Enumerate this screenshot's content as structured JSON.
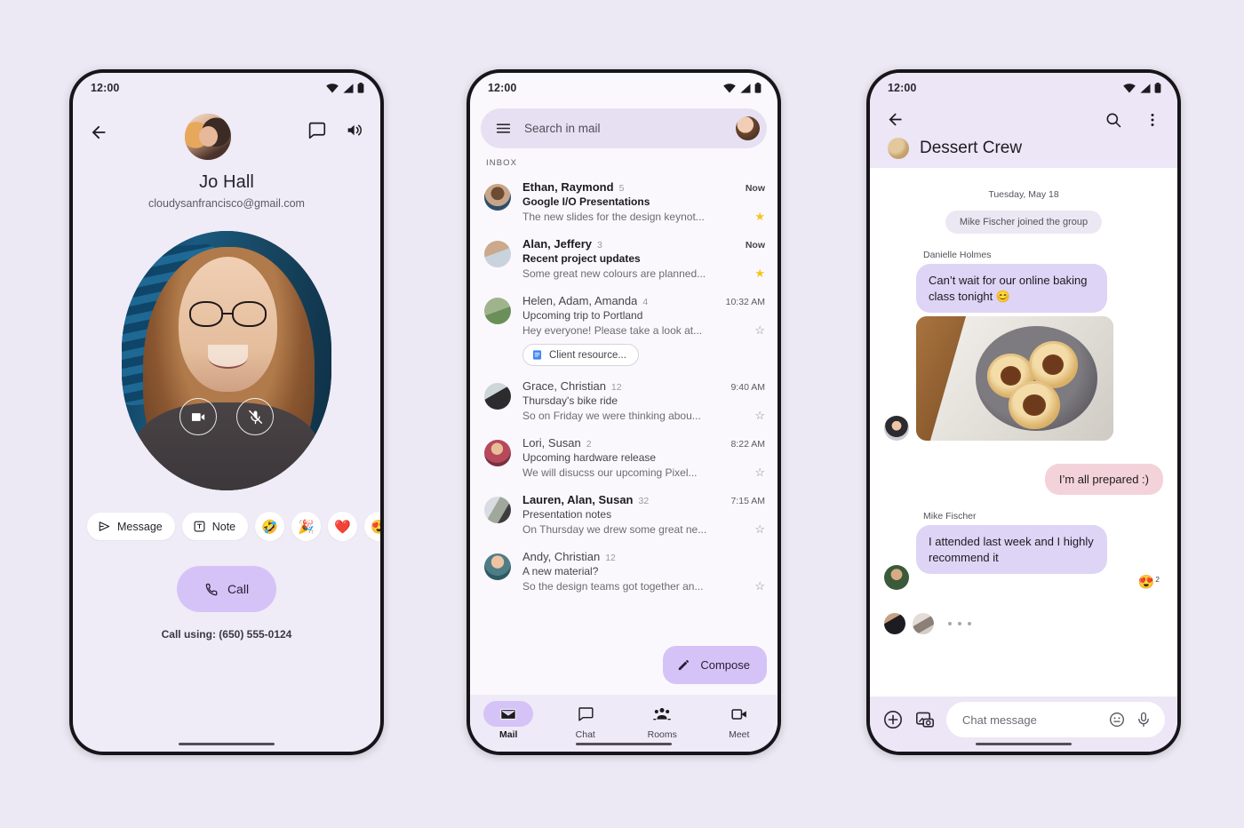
{
  "background_color": "#ece9f4",
  "accent_color": "#d5c3f7",
  "phone1": {
    "name": "contact-call-screen",
    "status": {
      "time": "12:00"
    },
    "header": {
      "back_icon": "arrow-back-icon",
      "chat_icon": "chat-bubble-icon",
      "volume_icon": "volume-up-icon"
    },
    "contact": {
      "name": "Jo Hall",
      "email": "cloudysanfrancisco@gmail.com"
    },
    "video": {
      "camera_icon": "video-camera-icon",
      "mic_muted_icon": "mic-off-icon"
    },
    "actions": [
      {
        "label": "Message",
        "icon": "send-icon",
        "type": "chip"
      },
      {
        "label": "Note",
        "icon": "note-icon",
        "type": "chip"
      },
      {
        "label": "🤣",
        "icon": "emoji-joy",
        "type": "emoji"
      },
      {
        "label": "🎉",
        "icon": "emoji-party",
        "type": "emoji"
      },
      {
        "label": "❤️",
        "icon": "emoji-heart",
        "type": "emoji"
      },
      {
        "label": "😍",
        "icon": "emoji-heart-eyes",
        "type": "emoji"
      }
    ],
    "call_button": {
      "label": "Call",
      "icon": "phone-icon"
    },
    "call_using": "Call using: (650) 555-0124"
  },
  "phone2": {
    "name": "gmail-inbox-screen",
    "status": {
      "time": "12:00"
    },
    "search": {
      "menu_icon": "hamburger-menu-icon",
      "placeholder": "Search in mail",
      "avatar": "account-avatar"
    },
    "section_label": "INBOX",
    "emails": [
      {
        "sender": "Ethan, Raymond",
        "count": "5",
        "time": "Now",
        "subject": "Google I/O Presentations",
        "snippet": "The new slides for the design keynot...",
        "unread": true,
        "starred": true,
        "avatar": "av-man1",
        "attachment": null
      },
      {
        "sender": "Alan, Jeffery",
        "count": "3",
        "time": "Now",
        "subject": "Recent project updates",
        "snippet": "Some great new colours are planned...",
        "unread": true,
        "starred": true,
        "avatar": "av-man2",
        "attachment": null
      },
      {
        "sender": "Helen, Adam, Amanda",
        "count": "4",
        "time": "10:32 AM",
        "subject": "Upcoming trip to Portland",
        "snippet": "Hey everyone! Please take a look at...",
        "unread": false,
        "starred": false,
        "avatar": "av-land",
        "attachment": {
          "label": "Client resource...",
          "icon": "google-docs-icon"
        }
      },
      {
        "sender": "Grace, Christian",
        "count": "12",
        "time": "9:40 AM",
        "subject": "Thursday's bike ride",
        "snippet": "So on Friday we were thinking abou...",
        "unread": false,
        "starred": false,
        "avatar": "av-dog",
        "attachment": null
      },
      {
        "sender": "Lori, Susan",
        "count": "2",
        "time": "8:22 AM",
        "subject": "Upcoming hardware release",
        "snippet": "We will disucss our upcoming Pixel...",
        "unread": false,
        "starred": false,
        "avatar": "av-woman1",
        "attachment": null
      },
      {
        "sender": "Lauren, Alan, Susan",
        "count": "32",
        "time": "7:15 AM",
        "subject": "Presentation notes",
        "snippet": "On Thursday we drew some great ne...",
        "unread": true,
        "starred": false,
        "avatar": "av-group",
        "attachment": null
      },
      {
        "sender": "Andy, Christian",
        "count": "12",
        "time": "",
        "subject": "A new material?",
        "snippet": "So the design teams got together an...",
        "unread": false,
        "starred": false,
        "avatar": "av-woman2",
        "attachment": null
      }
    ],
    "compose": {
      "label": "Compose",
      "icon": "pencil-icon"
    },
    "nav": [
      {
        "label": "Mail",
        "icon": "mail-icon",
        "active": true
      },
      {
        "label": "Chat",
        "icon": "chat-icon",
        "active": false
      },
      {
        "label": "Rooms",
        "icon": "rooms-icon",
        "active": false
      },
      {
        "label": "Meet",
        "icon": "meet-video-icon",
        "active": false
      }
    ]
  },
  "phone3": {
    "name": "chat-conversation-screen",
    "status": {
      "time": "12:00"
    },
    "appbar": {
      "back_icon": "arrow-back-icon",
      "search_icon": "search-icon",
      "overflow_icon": "more-vert-icon",
      "title": "Dessert Crew"
    },
    "date_divider": "Tuesday, May 18",
    "system_message": "Mike Fischer joined the group",
    "messages": [
      {
        "sender": "Danielle Holmes",
        "text": "Can’t wait for our online baking class tonight 😊",
        "direction": "in",
        "avatar": "av-woman3",
        "has_photo": true
      },
      {
        "sender": "",
        "text": "I’m all prepared :)",
        "direction": "out",
        "avatar": "",
        "has_photo": false
      },
      {
        "sender": "Mike Fischer",
        "text": "I attended last week and I highly recommend it",
        "direction": "in",
        "avatar": "av-man3",
        "has_photo": false,
        "reaction": {
          "emoji": "😍",
          "count": "2"
        }
      }
    ],
    "typing": {
      "avatars": [
        "av-dark",
        "av-blur"
      ],
      "dots": 3
    },
    "input": {
      "plus_icon": "add-circle-icon",
      "media_icon": "photo-camera-icon",
      "placeholder": "Chat message",
      "emoji_icon": "emoji-face-icon",
      "mic_icon": "microphone-icon"
    }
  }
}
